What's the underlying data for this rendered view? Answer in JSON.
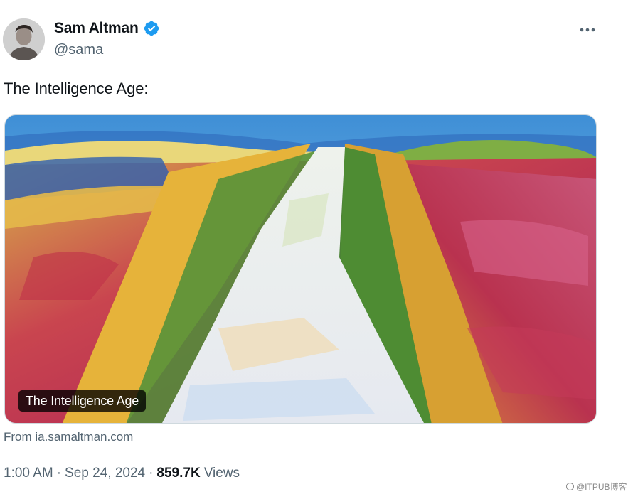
{
  "author": {
    "display_name": "Sam Altman",
    "handle": "@sama",
    "verified": true,
    "verified_color": "#1d9bf0",
    "avatar_icon": "person-avatar"
  },
  "menu": {
    "icon": "more-horizontal-icon"
  },
  "tweet": {
    "text": "The Intelligence Age:"
  },
  "link_card": {
    "image_alt": "Impressionist painting of a white path through colorful fields",
    "label": "The Intelligence Age",
    "source": "From ia.samaltman.com"
  },
  "meta": {
    "time": "1:00 AM",
    "separator": "·",
    "date": "Sep 24, 2024",
    "views_count": "859.7K",
    "views_label": "Views"
  },
  "watermark": {
    "text": "@ITPUB博客"
  },
  "colors": {
    "text_primary": "#0f1419",
    "text_secondary": "#536471",
    "accent": "#1d9bf0"
  }
}
